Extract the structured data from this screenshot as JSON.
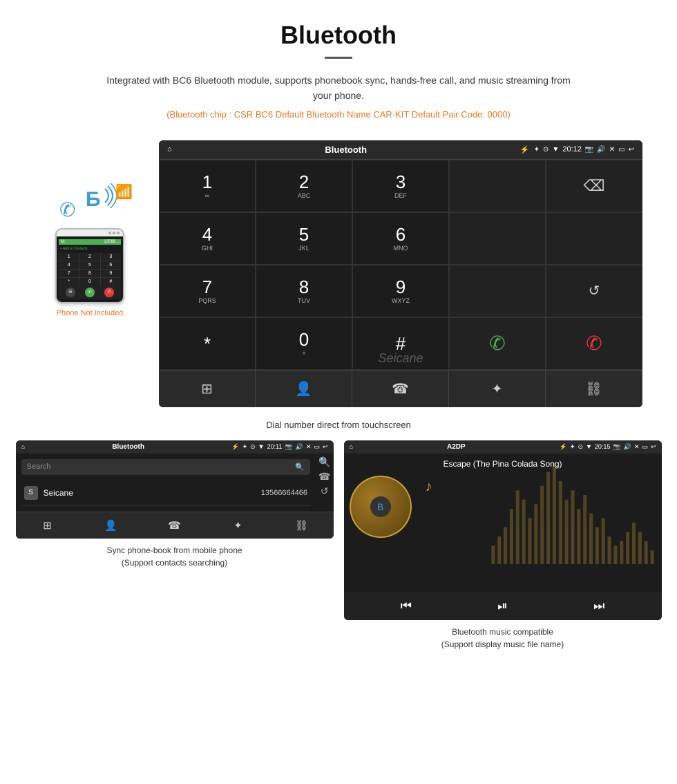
{
  "header": {
    "title": "Bluetooth",
    "description": "Integrated with BC6 Bluetooth module, supports phonebook sync, hands-free call, and music streaming from your phone.",
    "specs": "(Bluetooth chip : CSR BC6    Default Bluetooth Name CAR-KIT    Default Pair Code: 0000)"
  },
  "phone_not_included": "Phone Not Included",
  "dial_screen": {
    "title": "Bluetooth",
    "time": "20:12",
    "keys": [
      {
        "num": "1",
        "letters": "∞"
      },
      {
        "num": "2",
        "letters": "ABC"
      },
      {
        "num": "3",
        "letters": "DEF"
      },
      {
        "num": "",
        "letters": ""
      },
      {
        "num": "⌫",
        "letters": ""
      },
      {
        "num": "4",
        "letters": "GHI"
      },
      {
        "num": "5",
        "letters": "JKL"
      },
      {
        "num": "6",
        "letters": "MNO"
      },
      {
        "num": "",
        "letters": ""
      },
      {
        "num": "",
        "letters": ""
      },
      {
        "num": "7",
        "letters": "PQRS"
      },
      {
        "num": "8",
        "letters": "TUV"
      },
      {
        "num": "9",
        "letters": "WXYZ"
      },
      {
        "num": "",
        "letters": ""
      },
      {
        "num": "↺",
        "letters": ""
      },
      {
        "num": "*",
        "letters": ""
      },
      {
        "num": "0",
        "letters": "+"
      },
      {
        "num": "#",
        "letters": ""
      },
      {
        "num": "✆green",
        "letters": ""
      },
      {
        "num": "✆red",
        "letters": ""
      }
    ],
    "caption": "Dial number direct from touchscreen"
  },
  "phonebook_screen": {
    "title": "Bluetooth",
    "time": "20:11",
    "search_placeholder": "Search",
    "contact": {
      "letter": "S",
      "name": "Seicane",
      "phone": "13566664466"
    },
    "caption_line1": "Sync phone-book from mobile phone",
    "caption_line2": "(Support contacts searching)"
  },
  "music_screen": {
    "title": "A2DP",
    "time": "20:15",
    "song_title": "Escape (The Pina Colada Song)",
    "caption_line1": "Bluetooth music compatible",
    "caption_line2": "(Support display music file name)"
  },
  "icons": {
    "home": "⌂",
    "usb": "⚡",
    "bluetooth": "✦",
    "location": "⊙",
    "wifi": "▼",
    "camera": "📷",
    "volume": "🔊",
    "close": "✕",
    "window": "▭",
    "back": "↩",
    "search": "🔍",
    "phone": "📞",
    "refresh": "↺",
    "link": "🔗",
    "grid": "⊞",
    "person": "👤",
    "prev": "⏮",
    "playpause": "⏯",
    "next": "⏭"
  }
}
